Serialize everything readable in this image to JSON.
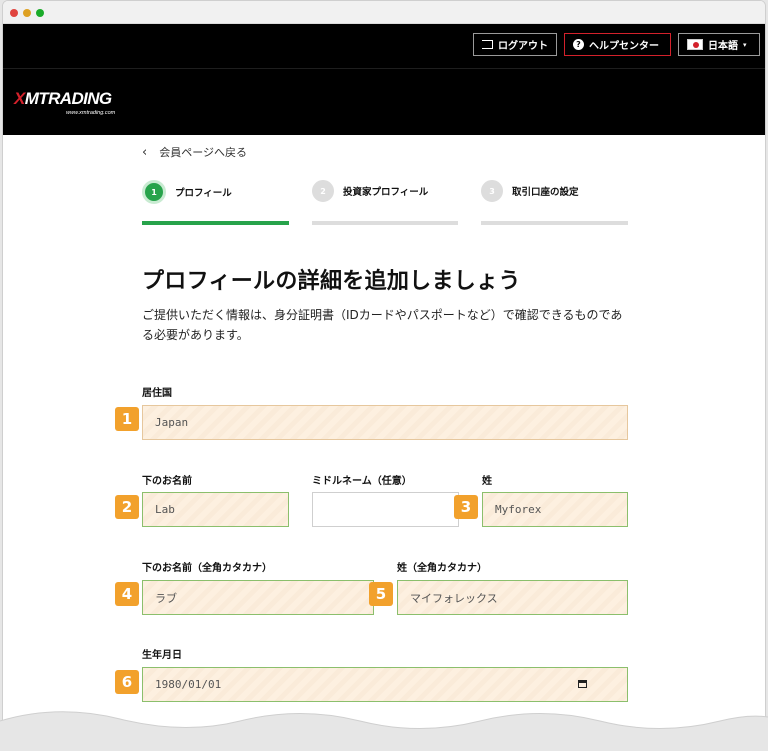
{
  "window": {
    "controls": [
      "close",
      "minimize",
      "maximize"
    ]
  },
  "topbar": {
    "logout_label": "ログアウト",
    "help_label": "ヘルプセンター",
    "help_icon_glyph": "?",
    "language_label": "日本語",
    "language_caret": "▾"
  },
  "brand": {
    "logo_text_x": "X",
    "logo_text_rest": "MTRADING",
    "logo_sub": "www.xmtrading.com"
  },
  "nav": {
    "back_arrow": "‹",
    "back_label": "会員ページへ戻る"
  },
  "steps": [
    {
      "number": "1",
      "label": "プロフィール",
      "active": true
    },
    {
      "number": "2",
      "label": "投資家プロフィール",
      "active": false
    },
    {
      "number": "3",
      "label": "取引口座の設定",
      "active": false
    }
  ],
  "page": {
    "title": "プロフィールの詳細を追加しましょう",
    "intro": "ご提供いただく情報は、身分証明書（IDカードやパスポートなど）で確認できるものである必要があります。"
  },
  "form": {
    "country": {
      "label": "居住国",
      "value": "Japan",
      "badge": "1"
    },
    "first_name": {
      "label": "下のお名前",
      "value": "Lab",
      "badge": "2"
    },
    "middle_name": {
      "label": "ミドルネーム（任意）",
      "value": ""
    },
    "last_name": {
      "label": "姓",
      "value": "Myforex",
      "badge": "3"
    },
    "first_name_kana": {
      "label": "下のお名前（全角カタカナ）",
      "value": "ラブ",
      "badge": "4"
    },
    "last_name_kana": {
      "label": "姓（全角カタカナ）",
      "value": "マイフォレックス",
      "badge": "5"
    },
    "birth_date": {
      "label": "生年月日",
      "value": "1980/01/01",
      "badge": "6"
    }
  },
  "colors": {
    "accent_green": "#27a34b",
    "brand_red": "#d3212b",
    "badge_orange": "#f2a12c"
  }
}
